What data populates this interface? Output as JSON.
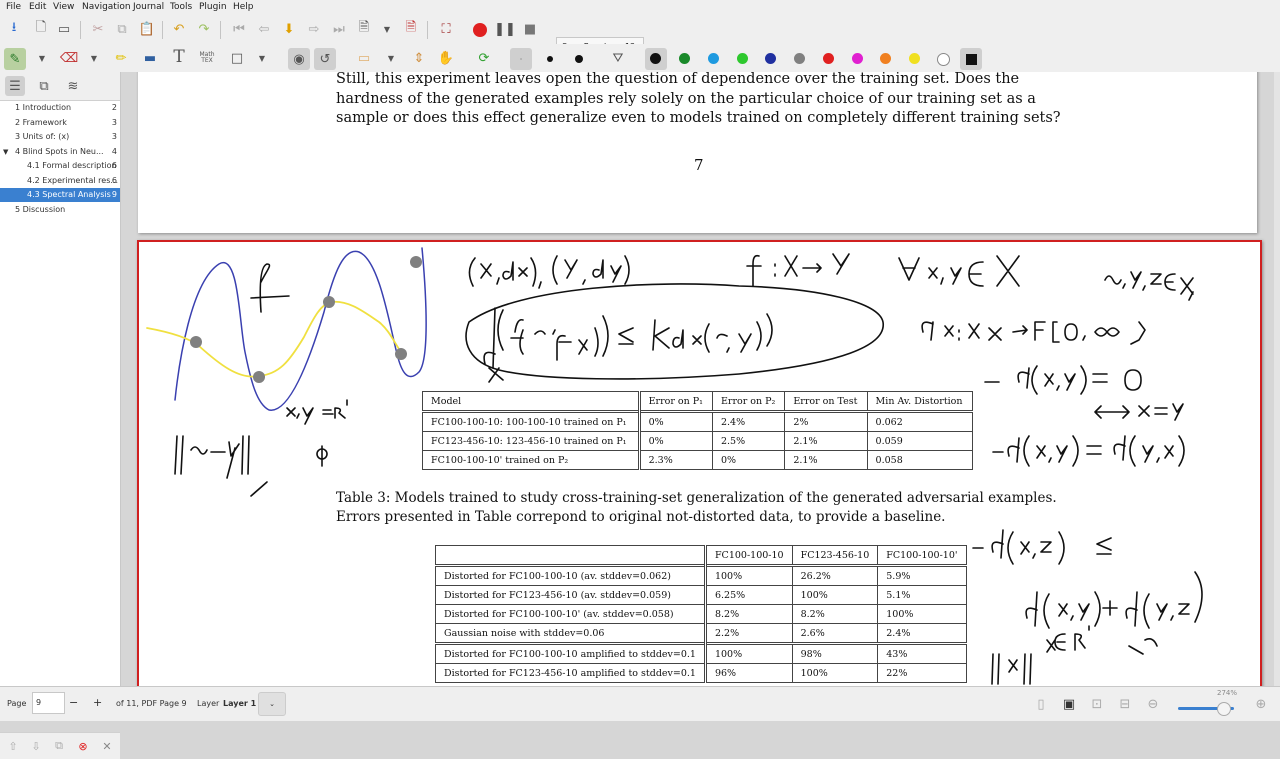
{
  "menu": [
    "File",
    "Edit",
    "View",
    "Navigation",
    "Journal",
    "Tools",
    "Plugin",
    "Help"
  ],
  "toolbar": {
    "font_name": "Sans Regular",
    "font_size": "12",
    "math_label": "Math TEX",
    "text_tool": "T",
    "pen_colors": [
      "#111111",
      "#1a8a2a",
      "#1e9ae0",
      "#2ec82e",
      "#2030a0",
      "#808080",
      "#e02020",
      "#e020d0",
      "#f08020",
      "#f0e020",
      "#ffffff"
    ]
  },
  "sidebar": {
    "toc": [
      {
        "title": "1 Introduction",
        "page": "2",
        "indent": 1
      },
      {
        "title": "2 Framework",
        "page": "3",
        "indent": 1
      },
      {
        "title": "3 Units of: (x)",
        "page": "3",
        "indent": 1
      },
      {
        "title": "4 Blind Spots in Neu...",
        "page": "4",
        "indent": 1,
        "expanded": true
      },
      {
        "title": "4.1 Formal description",
        "page": "6",
        "indent": 2
      },
      {
        "title": "4.2 Experimental res...",
        "page": "6",
        "indent": 2
      },
      {
        "title": "4.3 Spectral Analysis ...",
        "page": "9",
        "indent": 2,
        "selected": true
      },
      {
        "title": "5 Discussion",
        "page": "",
        "indent": 1
      }
    ]
  },
  "document": {
    "page1_text": "Still, this experiment leaves open the question of dependence over the training set. Does the hardness of the generated examples rely solely on the particular choice of our training set as a sample or does this effect generalize even to models trained on completely different training sets?",
    "page_number": "7",
    "table1": {
      "headers": [
        "Model",
        "Error on P₁",
        "Error on P₂",
        "Error on Test",
        "Min Av. Distortion"
      ],
      "rows": [
        [
          "FC100-100-10: 100-100-10 trained on P₁",
          "0%",
          "2.4%",
          "2%",
          "0.062"
        ],
        [
          "FC123-456-10: 123-456-10 trained on P₁",
          "0%",
          "2.5%",
          "2.1%",
          "0.059"
        ],
        [
          "FC100-100-10' trained on P₂",
          "2.3%",
          "0%",
          "2.1%",
          "0.058"
        ]
      ]
    },
    "caption": "Table 3: Models trained to study cross-training-set generalization of the generated adversarial examples. Errors presented in Table correpond to original not-distorted data, to provide a baseline.",
    "table2": {
      "headers": [
        "",
        "FC100-100-10",
        "FC123-456-10",
        "FC100-100-10'"
      ],
      "group1": [
        [
          "Distorted for FC100-100-10 (av. stddev=0.062)",
          "100%",
          "26.2%",
          "5.9%"
        ],
        [
          "Distorted for FC123-456-10 (av. stddev=0.059)",
          "6.25%",
          "100%",
          "5.1%"
        ],
        [
          "Distorted for FC100-100-10' (av. stddev=0.058)",
          "8.2%",
          "8.2%",
          "100%"
        ]
      ],
      "group2": [
        [
          "Gaussian noise with stddev=0.06",
          "2.2%",
          "2.6%",
          "2.4%"
        ]
      ],
      "group3": [
        [
          "Distorted for FC100-100-10 amplified to stddev=0.1",
          "100%",
          "98%",
          "43%"
        ],
        [
          "Distorted for FC123-456-10 amplified to stddev=0.1",
          "96%",
          "100%",
          "22%"
        ]
      ]
    }
  },
  "status": {
    "page_label": "Page",
    "page_value": "9",
    "minus": "−",
    "plus": "+",
    "of_pages": "of 11, PDF Page 9",
    "layer_label": "Layer",
    "layer_value": "Layer 1",
    "zoom": "274%"
  }
}
